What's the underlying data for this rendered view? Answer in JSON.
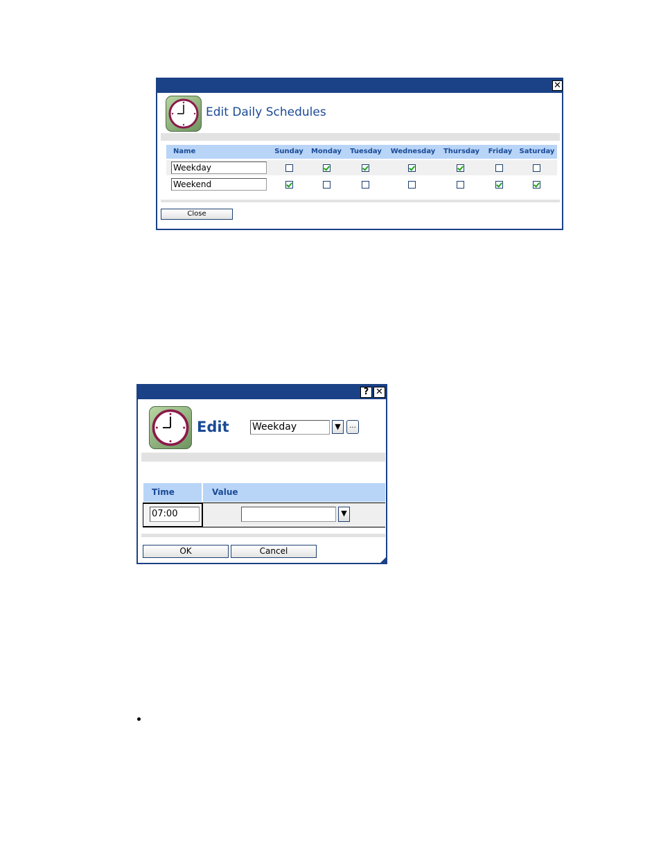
{
  "schedules_dialog": {
    "title": "Edit Daily Schedules",
    "columns": [
      "Name",
      "Sunday",
      "Monday",
      "Tuesday",
      "Wednesday",
      "Thursday",
      "Friday",
      "Saturday"
    ],
    "rows": [
      {
        "name": "Weekday",
        "days": [
          false,
          true,
          true,
          true,
          true,
          false,
          false
        ]
      },
      {
        "name": "Weekend",
        "days": [
          true,
          false,
          false,
          false,
          false,
          true,
          true
        ]
      }
    ],
    "close_label": "Close",
    "close_icon": "✕"
  },
  "edit_dialog": {
    "title": "Edit",
    "schedule_select_value": "Weekday",
    "dropdown_arrow": "▼",
    "browse_label": "...",
    "help_icon": "?",
    "close_icon": "✕",
    "columns": [
      "Time",
      "Value"
    ],
    "time_value": "07:00",
    "value_select_value": "",
    "ok_label": "OK",
    "cancel_label": "Cancel"
  },
  "colors": {
    "titlebar": "#1b4186",
    "header_bg": "#b8d5f8",
    "title_text": "#1b4a95"
  }
}
